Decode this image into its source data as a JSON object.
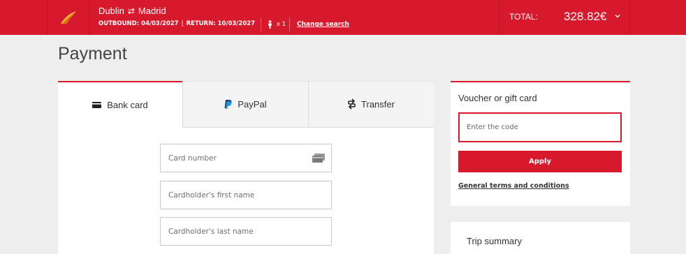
{
  "header": {
    "origin": "Dublin",
    "destination": "Madrid",
    "swap_icon": "swap-arrows-icon",
    "outbound": "OUTBOUND: 04/03/2027",
    "return": "RETURN: 10/03/2027",
    "passengers": "x 1",
    "change_search": "Change search",
    "total_label": "TOTAL:",
    "total_value": "328.82€"
  },
  "page": {
    "title": "Payment"
  },
  "payment": {
    "tabs": [
      {
        "label": "Bank card",
        "icon": "credit-card-icon"
      },
      {
        "label": "PayPal",
        "icon": "paypal-icon"
      },
      {
        "label": "Transfer",
        "icon": "transfer-icon"
      }
    ],
    "fields": {
      "card_number": "Card number",
      "first_name": "Cardholder's first name",
      "last_name": "Cardholder's last name"
    }
  },
  "voucher": {
    "title": "Voucher or gift card",
    "placeholder": "Enter the code",
    "apply": "Apply",
    "terms": "General terms and conditions"
  },
  "trip": {
    "title": "Trip summary"
  },
  "colors": {
    "brand": "#d7192d",
    "background": "#eeeeee"
  }
}
